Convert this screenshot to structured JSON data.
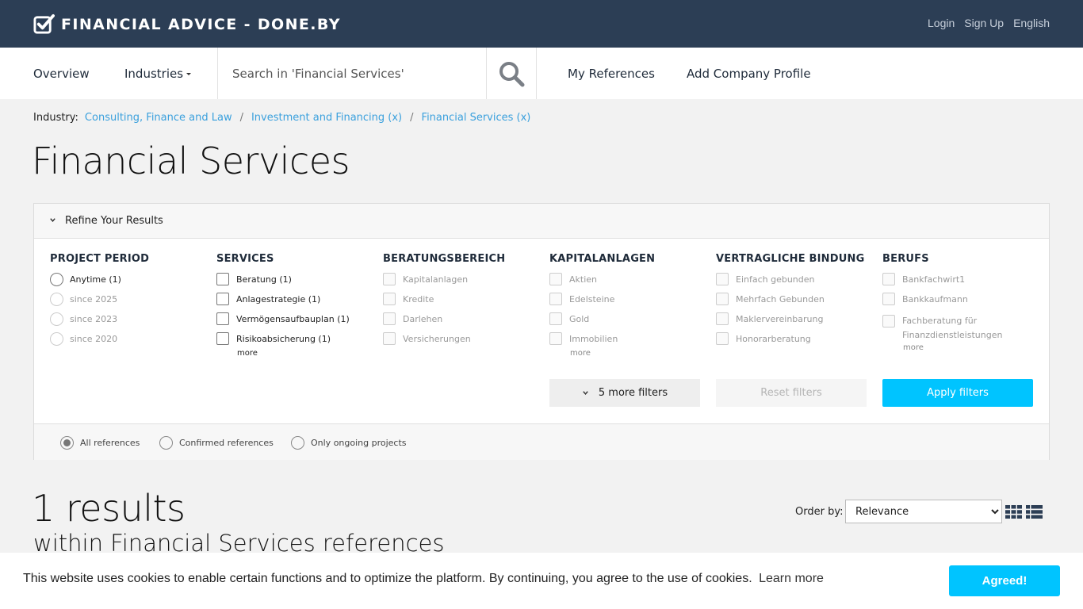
{
  "header": {
    "brand": "FINANCIAL ADVICE - DONE.BY",
    "links": [
      "Login",
      "Sign Up",
      "English"
    ]
  },
  "nav": {
    "overview": "Overview",
    "industries": "Industries",
    "search_placeholder": "Search in 'Financial Services'",
    "my_references": "My References",
    "add_company": "Add Company Profile"
  },
  "breadcrumb": {
    "label": "Industry:",
    "items": [
      "Consulting, Finance and Law",
      "Investment and Financing (x)",
      "Financial Services (x)"
    ],
    "separator": "/"
  },
  "page_title": "Financial Services",
  "filters": {
    "title": "Refine Your Results",
    "columns": [
      {
        "heading": "PROJECT PERIOD",
        "options": [
          "Anytime (1)",
          "since 2025",
          "since 2023",
          "since 2020"
        ]
      },
      {
        "heading": "SERVICES",
        "options": [
          "Beratung (1)",
          "Anlagestrategie (1)",
          "Vermögensaufbauplan (1)",
          "Risikoabsicherung (1)"
        ],
        "more": "more"
      },
      {
        "heading": "BERATUNGSBEREICH",
        "options": [
          "Kapitalanlagen",
          "Kredite",
          "Darlehen",
          "Versicherungen"
        ]
      },
      {
        "heading": "KAPITALANLAGEN",
        "options": [
          "Aktien",
          "Edelsteine",
          "Gold",
          "Immobilien"
        ],
        "more": "more"
      },
      {
        "heading": "VERTRAGLICHE BINDUNG",
        "options": [
          "Einfach gebunden",
          "Mehrfach Gebunden",
          "Maklervereinbarung",
          "Honorarberatung"
        ]
      },
      {
        "heading": "BERUFS",
        "options": [
          "Bankfachwirt1",
          "Bankkaufmann",
          "Fachberatung für Finanzdienstleistungen"
        ],
        "more": "more"
      }
    ],
    "more_filters": "5 more filters",
    "reset": "Reset filters",
    "apply": "Apply filters",
    "reference_types": [
      "All references",
      "Confirmed references",
      "Only ongoing projects"
    ]
  },
  "results": {
    "count": "1 results",
    "within": "within Financial Services references",
    "order_label": "Order by:",
    "order_value": "Relevance"
  },
  "cookie": {
    "text": "This website uses cookies to enable certain functions and to optimize the platform. By continuing, you agree to the use of cookies.",
    "learn_more": "Learn more",
    "button": "Agreed!"
  },
  "colors": {
    "header_bg": "#2c3e55",
    "accent": "#00c4ff",
    "link": "#3aa0dd"
  }
}
